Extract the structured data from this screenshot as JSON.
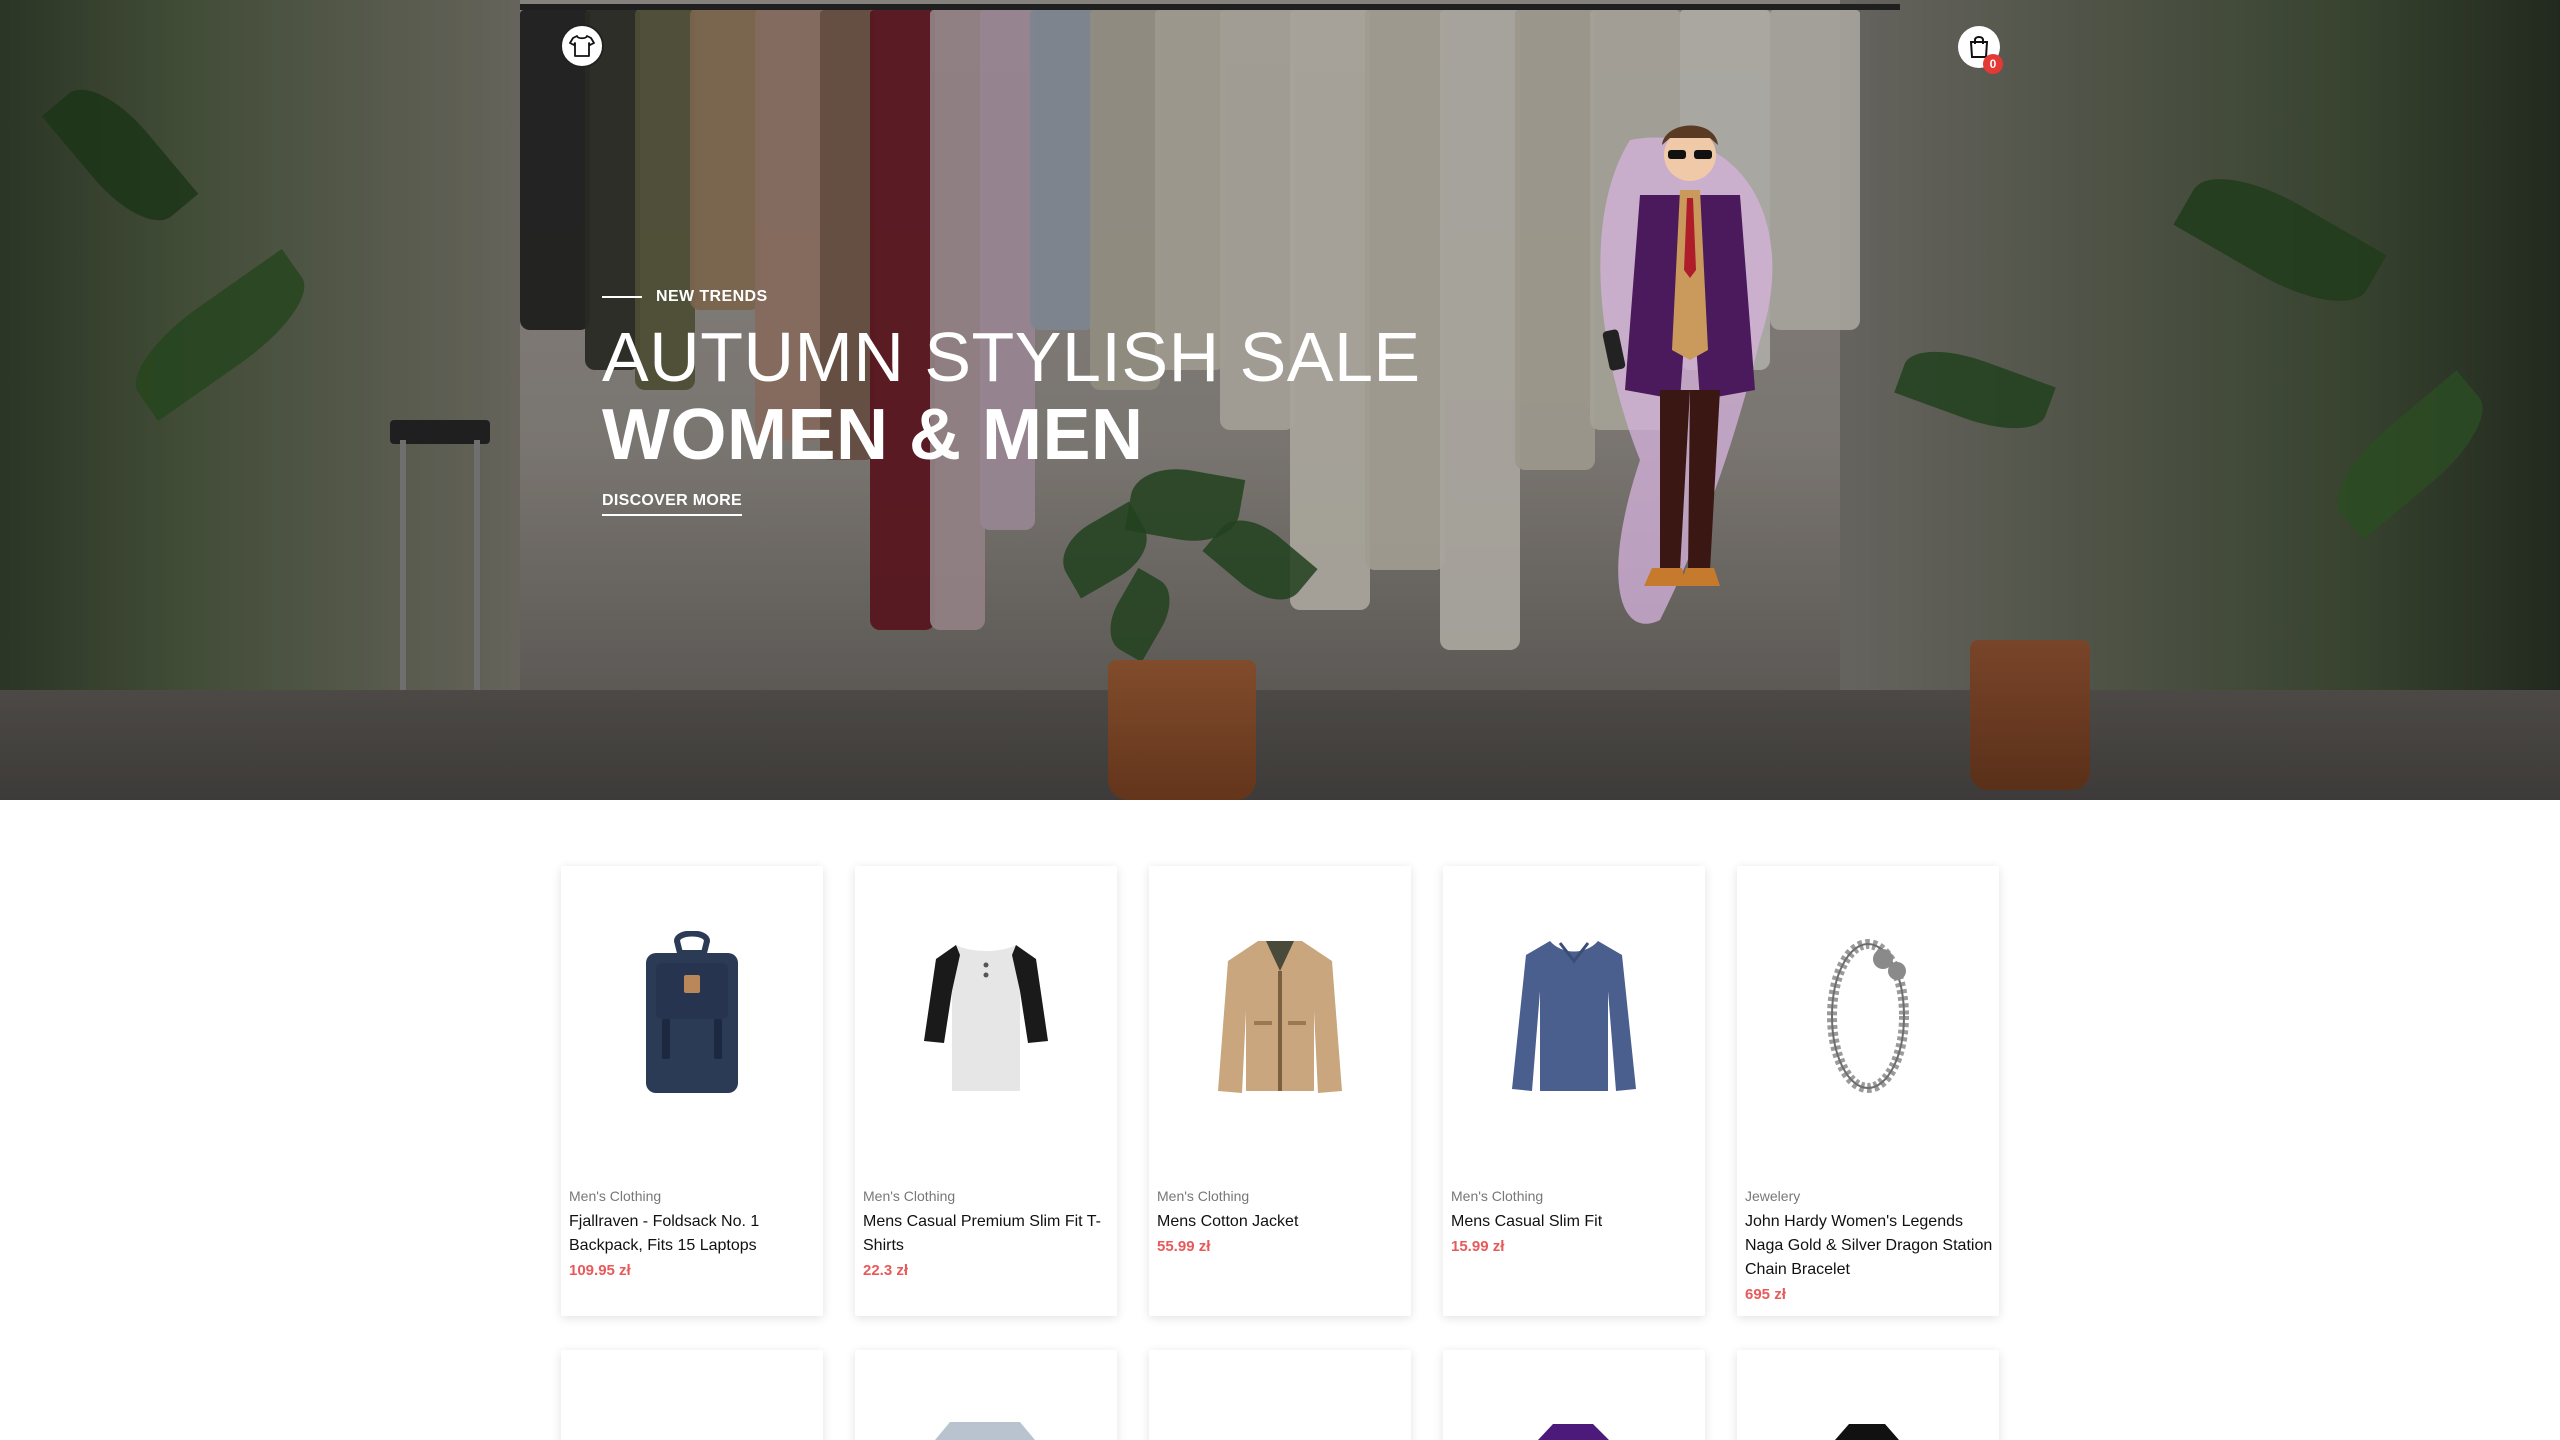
{
  "header": {
    "logo_icon": "tshirt-icon",
    "cart_icon": "shopping-bag-icon",
    "cart_count": "0"
  },
  "hero": {
    "eyebrow": "NEW TRENDS",
    "headline_line1": "AUTUMN STYLISH SALE",
    "headline_line2": "WOMEN & MEN",
    "cta_label": "DISCOVER MORE"
  },
  "products": [
    {
      "category": "Men's Clothing",
      "title": "Fjallraven - Foldsack No. 1 Backpack, Fits 15 Laptops",
      "price": "109.95 zł",
      "image_icon": "backpack-icon",
      "color": "#2b3a55"
    },
    {
      "category": "Men's Clothing",
      "title": "Mens Casual Premium Slim Fit T-Shirts",
      "price": "22.3 zł",
      "image_icon": "raglan-tshirt-icon",
      "color": "#e6e6e6"
    },
    {
      "category": "Men's Clothing",
      "title": "Mens Cotton Jacket",
      "price": "55.99 zł",
      "image_icon": "jacket-icon",
      "color": "#c9a67d"
    },
    {
      "category": "Men's Clothing",
      "title": "Mens Casual Slim Fit",
      "price": "15.99 zł",
      "image_icon": "longsleeve-shirt-icon",
      "color": "#4a5f8e"
    },
    {
      "category": "Jewelery",
      "title": "John Hardy Women's Legends Naga Gold & Silver Dragon Station Chain Bracelet",
      "price": "695 zł",
      "image_icon": "bracelet-icon",
      "color": "#9a9a9a"
    }
  ],
  "colors": {
    "price": "#e85a5a",
    "cart_badge": "#e53935",
    "model_coat": "#4b1a5c",
    "model_scarf": "#c99a5b"
  }
}
